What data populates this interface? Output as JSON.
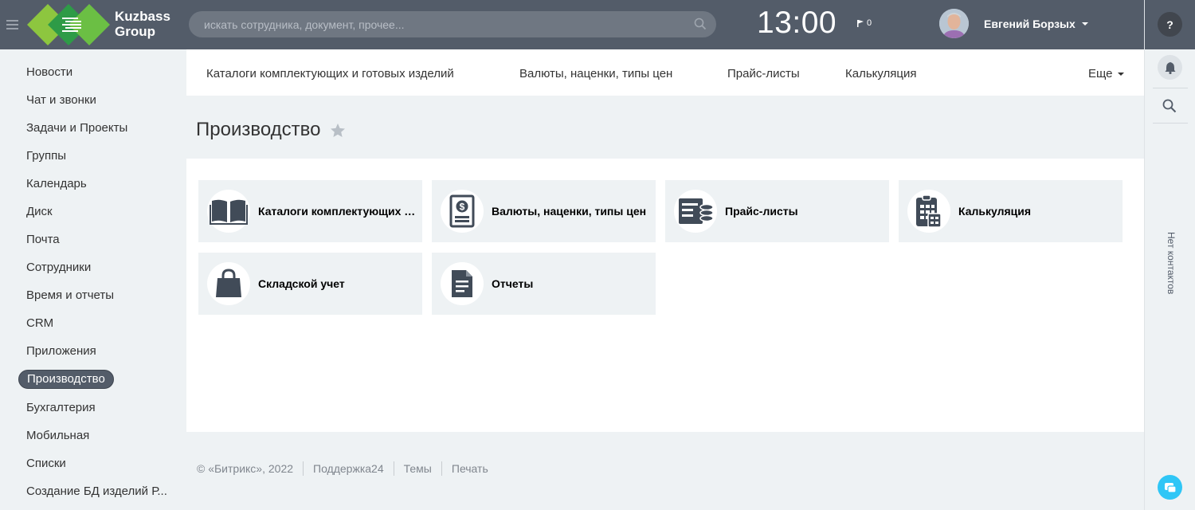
{
  "header": {
    "logo_line1": "Kuzbass",
    "logo_line2": "Group",
    "search_placeholder": "искать сотрудника, документ, прочее...",
    "clock": "13:00",
    "flag_count": "0",
    "user_name": "Евгений Борзых"
  },
  "right_panel": {
    "no_contacts": "Нет контактов"
  },
  "left_menu": {
    "items": [
      {
        "label": "Новости"
      },
      {
        "label": "Чат и звонки"
      },
      {
        "label": "Задачи и Проекты"
      },
      {
        "label": "Группы"
      },
      {
        "label": "Календарь"
      },
      {
        "label": "Диск"
      },
      {
        "label": "Почта"
      },
      {
        "label": "Сотрудники"
      },
      {
        "label": "Время и отчеты"
      },
      {
        "label": "CRM"
      },
      {
        "label": "Приложения"
      },
      {
        "label": "Производство",
        "active": true
      },
      {
        "label": "Бухгалтерия"
      },
      {
        "label": "Мобильная"
      },
      {
        "label": "Списки"
      },
      {
        "label": "Создание БД изделий Р..."
      }
    ]
  },
  "top_nav": {
    "items": [
      {
        "label": "Каталоги комплектующих и готовых изделий"
      },
      {
        "label": "Валюты, наценки, типы цен"
      },
      {
        "label": "Прайс-листы"
      },
      {
        "label": "Калькуляция"
      }
    ],
    "more_label": "Еще"
  },
  "page": {
    "title": "Производство"
  },
  "tiles": [
    {
      "label": "Каталоги комплектующих и готовых изделий",
      "icon": "book-icon"
    },
    {
      "label": "Валюты, наценки, типы цен",
      "icon": "price-document-icon"
    },
    {
      "label": "Прайс-листы",
      "icon": "price-list-coins-icon"
    },
    {
      "label": "Калькуляция",
      "icon": "calculator-icon"
    },
    {
      "label": "Складской учет",
      "icon": "shopping-bag-icon"
    },
    {
      "label": "Отчеты",
      "icon": "document-icon"
    }
  ],
  "footer": {
    "copyright": "© «Битрикс», 2022",
    "support": "Поддержка24",
    "themes": "Темы",
    "print": "Печать"
  },
  "colors": {
    "header_bg": "#535c69",
    "icon_dark": "#414b58",
    "tile_bg": "#eef2f4",
    "accent_chat": "#2fc6f6"
  }
}
